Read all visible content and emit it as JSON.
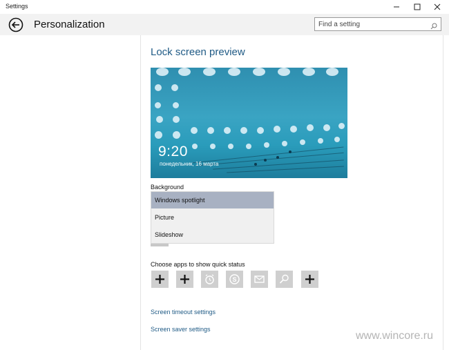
{
  "window": {
    "title": "Settings"
  },
  "header": {
    "page_title": "Personalization",
    "search_placeholder": "Find a setting"
  },
  "main": {
    "section_title": "Lock screen preview",
    "preview": {
      "time": "9:20",
      "date": "понедельник, 16 марта"
    },
    "background": {
      "label": "Background",
      "options": [
        "Windows spotlight",
        "Picture",
        "Slideshow"
      ],
      "selected": "Windows spotlight"
    },
    "quick_status": {
      "label": "Choose apps to show quick status",
      "icons": [
        "plus-icon",
        "plus-icon",
        "alarm-icon",
        "skype-icon",
        "mail-icon",
        "search-icon",
        "plus-icon"
      ]
    },
    "links": {
      "screen_timeout": "Screen timeout settings",
      "screen_saver": "Screen saver settings"
    }
  },
  "watermark": "www.wincore.ru",
  "colors": {
    "accent": "#1f5a85",
    "selected_option": "#a8b1c2",
    "tile": "#cfcfcf"
  }
}
